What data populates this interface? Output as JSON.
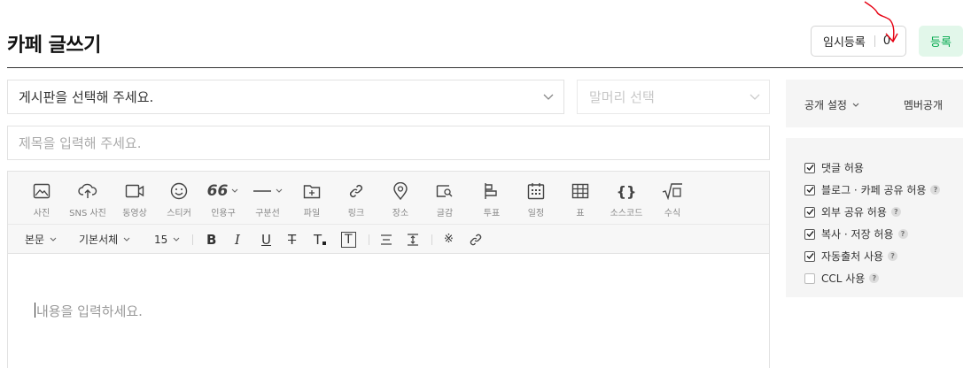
{
  "page": {
    "title": "카페 글쓰기",
    "temp_save_label": "임시등록",
    "temp_save_count": "0",
    "register_label": "등록"
  },
  "board": {
    "placeholder": "게시판을 선택해 주세요.",
    "head_placeholder": "말머리 선택"
  },
  "subject": {
    "placeholder": "제목을 입력해 주세요."
  },
  "toolbar": {
    "items": [
      {
        "label": "사진",
        "icon": "photo-icon"
      },
      {
        "label": "SNS 사진",
        "icon": "cloud-upload-icon"
      },
      {
        "label": "동영상",
        "icon": "video-icon"
      },
      {
        "label": "스티커",
        "icon": "sticker-icon"
      },
      {
        "label": "인용구",
        "icon": "quote-icon"
      },
      {
        "label": "구분선",
        "icon": "divider-icon"
      },
      {
        "label": "파일",
        "icon": "file-icon"
      },
      {
        "label": "링크",
        "icon": "link-icon"
      },
      {
        "label": "장소",
        "icon": "place-icon"
      },
      {
        "label": "글감",
        "icon": "material-icon"
      },
      {
        "label": "투표",
        "icon": "vote-icon"
      },
      {
        "label": "일정",
        "icon": "calendar-icon"
      },
      {
        "label": "표",
        "icon": "table-icon"
      },
      {
        "label": "소스코드",
        "icon": "code-icon"
      },
      {
        "label": "수식",
        "icon": "formula-icon"
      }
    ]
  },
  "format": {
    "paragraph": "본문",
    "font": "기본서체",
    "size": "15"
  },
  "editor": {
    "placeholder": "내용을 입력하세요."
  },
  "sidebar": {
    "public_setting": "공개 설정",
    "public_value": "멤버공개",
    "options": [
      {
        "label": "댓글 허용",
        "checked": true,
        "help": false
      },
      {
        "label": "블로그 · 카페 공유 허용",
        "checked": true,
        "help": true
      },
      {
        "label": "외부 공유 허용",
        "checked": true,
        "help": true
      },
      {
        "label": "복사 · 저장 허용",
        "checked": true,
        "help": true
      },
      {
        "label": "자동출처 사용",
        "checked": true,
        "help": true
      },
      {
        "label": "CCL 사용",
        "checked": false,
        "help": true
      }
    ]
  },
  "colors": {
    "accent_green": "#03a94d",
    "register_bg": "#e2f7ea",
    "annotation_red": "#e60012"
  }
}
